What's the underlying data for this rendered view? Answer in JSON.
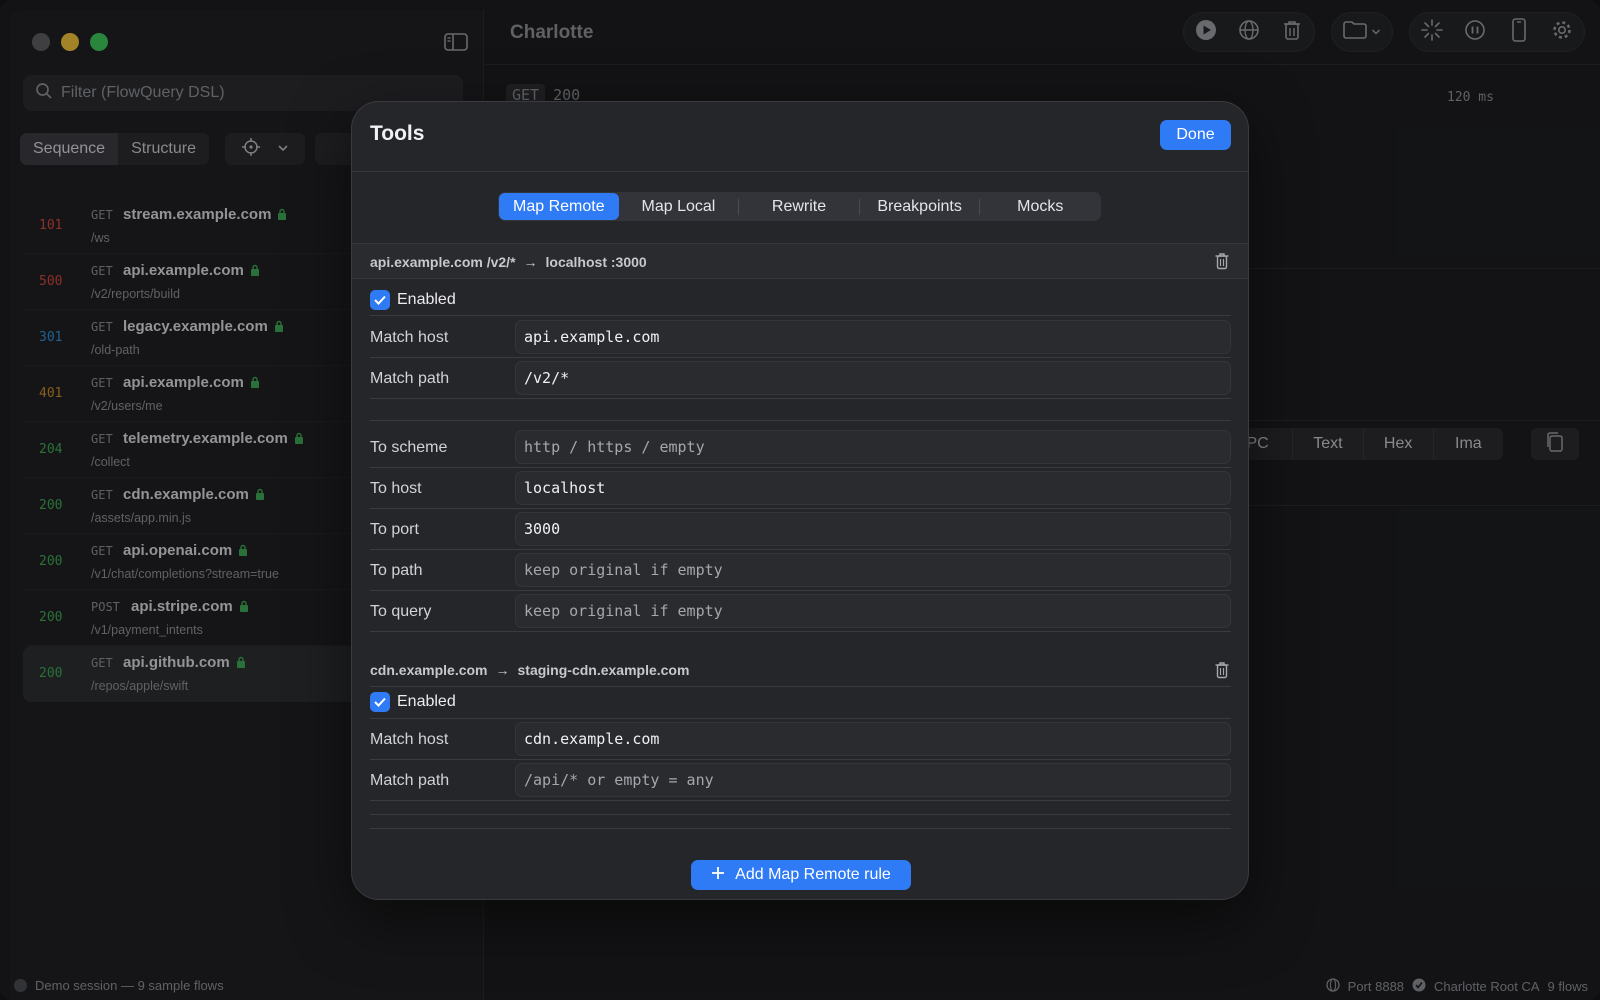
{
  "sidebar": {
    "filter_placeholder": "Filter (FlowQuery DSL)",
    "view_tabs": [
      "Sequence",
      "Structure"
    ],
    "flows": [
      {
        "status": "101",
        "status_color": "#d0473f",
        "method": "GET",
        "host": "stream.example.com",
        "path": "/ws"
      },
      {
        "status": "500",
        "status_color": "#d0473f",
        "method": "GET",
        "host": "api.example.com",
        "path": "/v2/reports/build"
      },
      {
        "status": "301",
        "status_color": "#2f8fd8",
        "method": "GET",
        "host": "legacy.example.com",
        "path": "/old-path"
      },
      {
        "status": "401",
        "status_color": "#c98a2e",
        "method": "GET",
        "host": "api.example.com",
        "path": "/v2/users/me"
      },
      {
        "status": "204",
        "status_color": "#3fa755",
        "method": "GET",
        "host": "telemetry.example.com",
        "path": "/collect"
      },
      {
        "status": "200",
        "status_color": "#3fa755",
        "method": "GET",
        "host": "cdn.example.com",
        "path": "/assets/app.min.js"
      },
      {
        "status": "200",
        "status_color": "#3fa755",
        "method": "GET",
        "host": "api.openai.com",
        "path": "/v1/chat/completions?stream=true"
      },
      {
        "status": "200",
        "status_color": "#3fa755",
        "method": "POST",
        "host": "api.stripe.com",
        "path": "/v1/payment_intents"
      },
      {
        "status": "200",
        "status_color": "#3fa755",
        "method": "GET",
        "host": "api.github.com",
        "path": "/repos/apple/swift",
        "selected": true
      }
    ]
  },
  "main": {
    "title": "Charlotte",
    "request_method": "GET",
    "request_status": "200",
    "timing": "120 ms",
    "body_tabs": [
      "PC",
      "Text",
      "Hex",
      "Ima"
    ]
  },
  "status_bar": {
    "session": "Demo session — 9 sample flows",
    "port": "Port 8888",
    "ca": "Charlotte Root CA",
    "flow_count": "9 flows"
  },
  "modal": {
    "title": "Tools",
    "done_label": "Done",
    "tabs": [
      "Map Remote",
      "Map Local",
      "Rewrite",
      "Breakpoints",
      "Mocks"
    ],
    "active_tab": "Map Remote",
    "rules": [
      {
        "from": "api.example.com /v2/*",
        "to": "localhost :3000",
        "enabled_label": "Enabled",
        "enabled": true,
        "match_host": {
          "label": "Match host",
          "value": "api.example.com",
          "placeholder": ""
        },
        "match_path": {
          "label": "Match path",
          "value": "/v2/*",
          "placeholder": ""
        },
        "to_scheme": {
          "label": "To scheme",
          "value": "",
          "placeholder": "http / https / empty"
        },
        "to_host": {
          "label": "To host",
          "value": "localhost",
          "placeholder": ""
        },
        "to_port": {
          "label": "To port",
          "value": "3000",
          "placeholder": ""
        },
        "to_path": {
          "label": "To path",
          "value": "",
          "placeholder": "keep original if empty"
        },
        "to_query": {
          "label": "To query",
          "value": "",
          "placeholder": "keep original if empty"
        }
      },
      {
        "from": "cdn.example.com",
        "to": "staging-cdn.example.com",
        "enabled_label": "Enabled",
        "enabled": true,
        "match_host": {
          "label": "Match host",
          "value": "cdn.example.com",
          "placeholder": ""
        },
        "match_path": {
          "label": "Match path",
          "value": "",
          "placeholder": "/api/* or empty = any"
        }
      }
    ],
    "add_rule_label": "Add Map Remote rule"
  },
  "colors": {
    "accent": "#2f7bf5",
    "lock": "#3fa755"
  }
}
